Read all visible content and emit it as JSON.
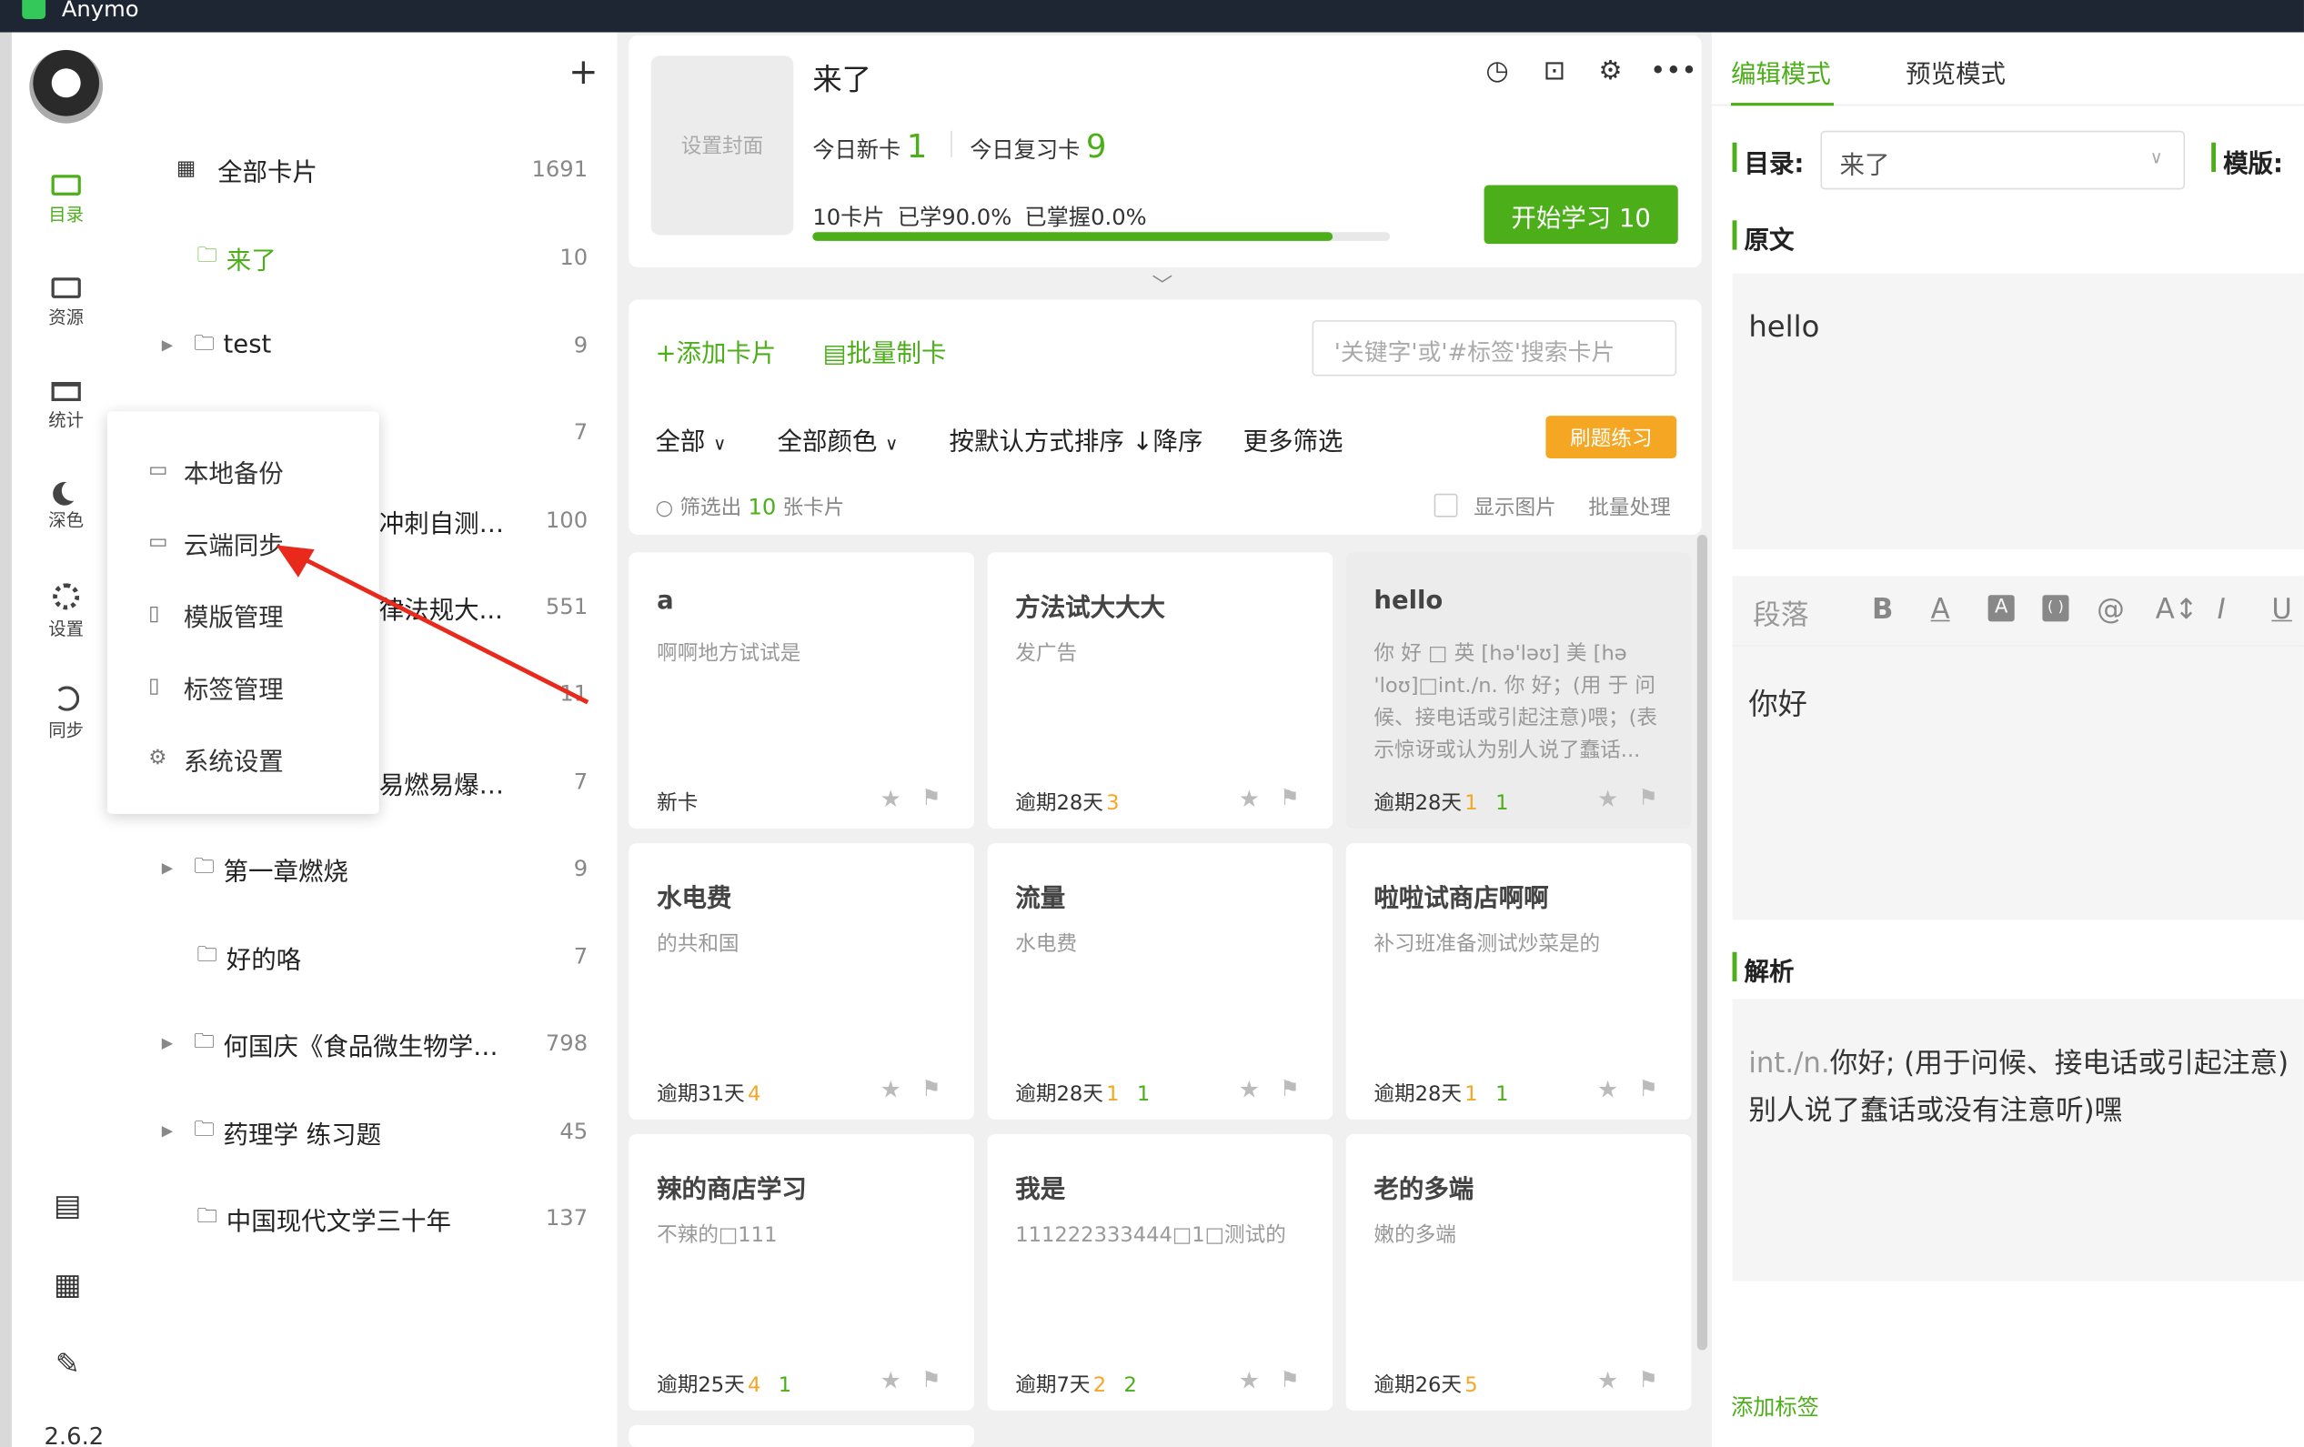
{
  "app": {
    "title": "Anymo",
    "version": "2.6.2"
  },
  "sidebar_nav": [
    {
      "name": "catalog",
      "label": "目录",
      "icon": "monitor-icon",
      "active": true
    },
    {
      "name": "resources",
      "label": "资源",
      "icon": "resource-icon",
      "active": false
    },
    {
      "name": "stats",
      "label": "统计",
      "icon": "board-icon",
      "active": false
    },
    {
      "name": "dark",
      "label": "深色",
      "icon": "moon-icon",
      "active": false
    },
    {
      "name": "settings",
      "label": "设置",
      "icon": "gear-icon",
      "active": false
    },
    {
      "name": "sync",
      "label": "同步",
      "icon": "sync-icon",
      "active": false
    }
  ],
  "tree": {
    "all": {
      "label": "全部卡片",
      "count": "1691"
    },
    "items": [
      {
        "label": "来了",
        "count": "10",
        "active": true,
        "expandable": false
      },
      {
        "label": "test",
        "count": "9",
        "expandable": true
      },
      {
        "label": "",
        "count": "7",
        "expandable": false
      },
      {
        "label": "冲刺自测评...",
        "count": "100",
        "expandable": false
      },
      {
        "label": "律法规大...",
        "count": "551",
        "expandable": false
      },
      {
        "label": "",
        "count": "11",
        "expandable": false
      },
      {
        "label": "易燃易爆危险...",
        "count": "7",
        "expandable": false
      },
      {
        "label": "第一章燃烧",
        "count": "9",
        "expandable": true
      },
      {
        "label": "好的咯",
        "count": "7",
        "expandable": false
      },
      {
        "label": "何国庆《食品微生物学》...",
        "count": "798",
        "expandable": true
      },
      {
        "label": "药理学 练习题",
        "count": "45",
        "expandable": true
      },
      {
        "label": "中国现代文学三十年",
        "count": "137",
        "expandable": false
      }
    ]
  },
  "popup_menu": [
    {
      "label": "本地备份",
      "icon": "backup-icon"
    },
    {
      "label": "云端同步",
      "icon": "cloud-sync-icon"
    },
    {
      "label": "模版管理",
      "icon": "template-icon"
    },
    {
      "label": "标签管理",
      "icon": "tag-icon"
    },
    {
      "label": "系统设置",
      "icon": "settings-icon"
    }
  ],
  "deck": {
    "cover_label": "设置封面",
    "title": "来了",
    "today_new_label": "今日新卡",
    "today_new": "1",
    "today_review_label": "今日复习卡",
    "today_review": "9",
    "progress_text": "10卡片 已学90.0% 已掌握0.0%",
    "progress_value": 0.9,
    "start_button": "开始学习 10"
  },
  "card_list": {
    "add_card": "+添加卡片",
    "batch_make": "批量制卡",
    "search_placeholder": "'关键字'或'#标签'搜索卡片",
    "filter_all": "全部",
    "filter_color": "全部颜色",
    "sort": "按默认方式排序 ↓降序",
    "more_filters": "更多筛选",
    "practice": "刷题练习",
    "filtered_prefix": "筛选出",
    "filtered_count": "10",
    "filtered_suffix": "张卡片",
    "show_images": "显示图片",
    "batch_process": "批量处理"
  },
  "cards": [
    {
      "title": "a",
      "body": "啊啊地方试试是",
      "due": "新卡",
      "orange": "",
      "green": ""
    },
    {
      "title": "方法试大大大",
      "body": "发广告",
      "due": "逾期28天",
      "orange": "3",
      "green": ""
    },
    {
      "title": "hello",
      "body": "你 好 □ 英 [hə'ləʊ]     美 [hə 'loʊ]□int./n. 你 好；(用 于 问 候、接电话或引起注意)喂；(表 示惊讶或认为别人说了蠢话...",
      "due": "逾期28天",
      "orange": "1",
      "green": "1",
      "selected": true
    },
    {
      "title": "水电费",
      "body": "的共和国",
      "due": "逾期31天",
      "orange": "4",
      "green": ""
    },
    {
      "title": "流量",
      "body": "水电费",
      "due": "逾期28天",
      "orange": "1",
      "green": "1"
    },
    {
      "title": "啦啦试商店啊啊",
      "body": "补习班准备测试炒菜是的",
      "due": "逾期28天",
      "orange": "1",
      "green": "1"
    },
    {
      "title": "辣的商店学习",
      "body": "不辣的□111",
      "due": "逾期25天",
      "orange": "4",
      "green": "1"
    },
    {
      "title": "我是",
      "body": "111222333444□1□测试的",
      "due": "逾期7天",
      "orange": "2",
      "green": "2"
    },
    {
      "title": "老的多端",
      "body": "嫩的多端",
      "due": "逾期26天",
      "orange": "5",
      "green": ""
    }
  ],
  "editor": {
    "tab_edit": "编辑模式",
    "tab_preview": "预览模式",
    "dir_label": "目录:",
    "dir_value": "来了",
    "template_label": "模版:",
    "original_label": "原文",
    "original_text": "hello",
    "toolbar_paragraph": "段落",
    "toolbar_buttons": [
      "B",
      "A",
      "A",
      "( )",
      "@",
      "A↕",
      "I",
      "U"
    ],
    "front_text": "你好",
    "analysis_label": "解析",
    "analysis_line1_gray": "int./n.",
    "analysis_line1": "你好; (用于问候、接电话或引起注意)",
    "analysis_line2": "别人说了蠢话或没有注意听)嘿",
    "add_tag": "添加标签"
  },
  "colors": {
    "accent": "#4caf1a",
    "orange": "#f5a623",
    "titlebar": "#1f2633"
  }
}
